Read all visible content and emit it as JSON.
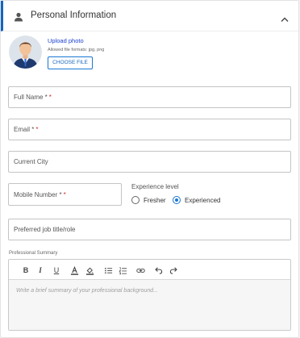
{
  "section": {
    "title": "Personal Information",
    "icon": "person-icon",
    "collapse_icon": "chevron-up-icon",
    "accent_color": "#1565c0"
  },
  "photo": {
    "upload_label": "Upload photo",
    "formats_text": "Allowed file formats: jpg, png",
    "choose_button": "CHOOSE FILE"
  },
  "form": {
    "full_name": {
      "label": "Full Name *",
      "required_mark": "*"
    },
    "email": {
      "label": "Email *",
      "required_mark": "*"
    },
    "current_city": {
      "label": "Current City"
    },
    "mobile": {
      "label": "Mobile Number *",
      "required_mark": "*"
    },
    "experience": {
      "label": "Experience level",
      "options": [
        "Fresher",
        "Experienced"
      ],
      "selected": "Experienced"
    },
    "job_title": {
      "label": "Preferred job title/role"
    },
    "summary": {
      "label": "Professional Summary",
      "placeholder": "Write a brief summary of your professional background...",
      "toolbar": [
        "bold",
        "italic",
        "underline",
        "text-color",
        "highlight",
        "bulleted-list",
        "numbered-list",
        "link",
        "undo",
        "redo"
      ]
    }
  }
}
